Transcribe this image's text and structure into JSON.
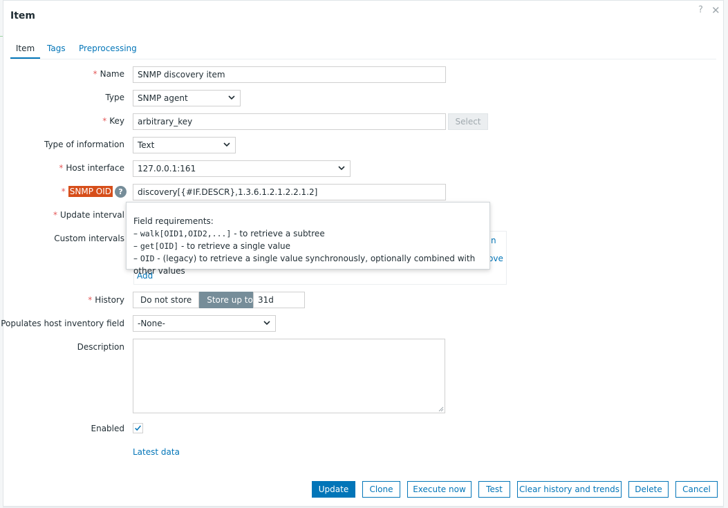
{
  "dialog": {
    "title": "Item"
  },
  "tabs": [
    {
      "label": "Item"
    },
    {
      "label": "Tags"
    },
    {
      "label": "Preprocessing"
    }
  ],
  "form": {
    "required_marker": "*",
    "name": {
      "label": "Name",
      "value": "SNMP discovery item"
    },
    "type": {
      "label": "Type",
      "value": "SNMP agent"
    },
    "key": {
      "label": "Key",
      "value": "arbitrary_key",
      "select_label": "Select"
    },
    "type_of_information": {
      "label": "Type of information",
      "value": "Text"
    },
    "host_interface": {
      "label": "Host interface",
      "value": "127.0.0.1:161"
    },
    "snmp_oid": {
      "label": "SNMP OID",
      "value": "discovery[{#IF.DESCR},1.3.6.1.2.1.2.2.1.2]",
      "help_glyph": "?"
    },
    "update_interval": {
      "label": "Update interval"
    },
    "custom_intervals": {
      "label": "Custom intervals",
      "peek_right_1": "n",
      "peek_right_2": "ove",
      "add_label": "Add"
    },
    "history": {
      "label": "History",
      "options": [
        "Do not store",
        "Store up to"
      ],
      "selected": "Store up to",
      "value": "31d"
    },
    "inventory_field": {
      "label": "Populates host inventory field",
      "value": "-None-"
    },
    "description": {
      "label": "Description",
      "value": ""
    },
    "enabled": {
      "label": "Enabled",
      "checked": true
    },
    "latest_data_link": "Latest data"
  },
  "tooltip": {
    "heading": "Field requirements:",
    "dash": "–",
    "lines": [
      {
        "code": "walk[OID1,OID2,...]",
        "text": " - to retrieve a subtree"
      },
      {
        "code": "get[OID]",
        "text": " - to retrieve a single value"
      },
      {
        "code": "OID",
        "text": " - (legacy) to retrieve a single value synchronously, optionally combined with other values"
      }
    ]
  },
  "buttons": {
    "update": "Update",
    "clone": "Clone",
    "execute_now": "Execute now",
    "test": "Test",
    "clear_history": "Clear history and trends",
    "delete": "Delete",
    "cancel": "Cancel"
  },
  "colors": {
    "accent": "#0275b8",
    "required": "#e45959",
    "oid_highlight": "#d64e1a",
    "segment_active": "#768d99"
  }
}
